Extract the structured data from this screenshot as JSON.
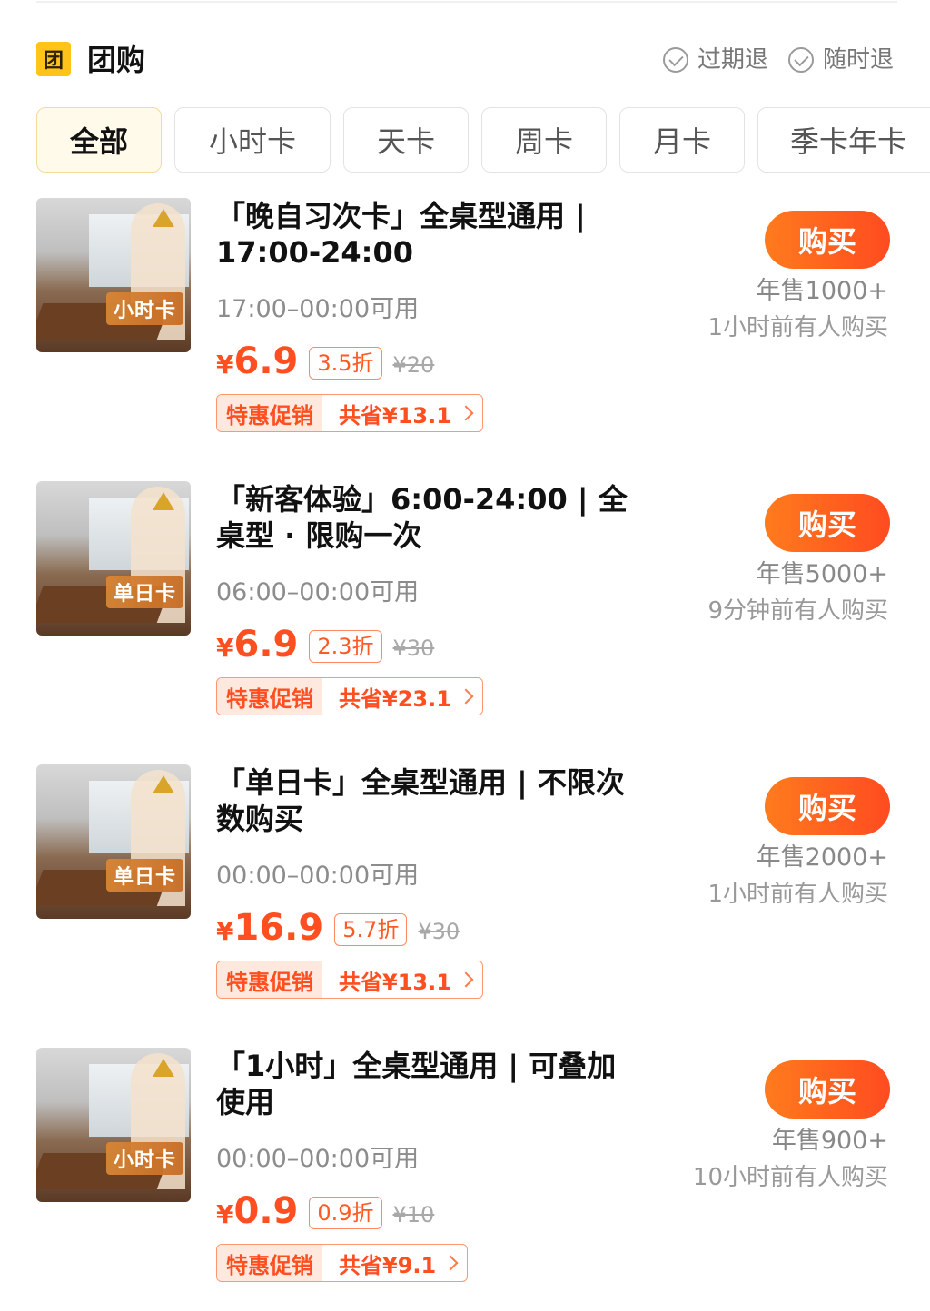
{
  "header": {
    "logo_char": "团",
    "title": "团购",
    "badges": [
      "过期退",
      "随时退"
    ]
  },
  "tabs": [
    "全部",
    "小时卡",
    "天卡",
    "周卡",
    "月卡",
    "季卡年卡"
  ],
  "active_tab": "全部",
  "items": [
    {
      "thumb_label": "小时卡",
      "title": "「晚自习次卡」全桌型通用 | 17:00-24:00",
      "time": "17:00–00:00可用",
      "price_symbol": "¥",
      "price": "6.9",
      "discount": "3.5折",
      "original": "¥20",
      "promo_tag": "特惠促销",
      "promo_save": "共省¥13.1",
      "buy": "购买",
      "sales": "年售1000+",
      "recent": "1小时前有人购买"
    },
    {
      "thumb_label": "单日卡",
      "title": "「新客体验」6:00-24:00 | 全桌型 · 限购一次",
      "time": "06:00–00:00可用",
      "price_symbol": "¥",
      "price": "6.9",
      "discount": "2.3折",
      "original": "¥30",
      "promo_tag": "特惠促销",
      "promo_save": "共省¥23.1",
      "buy": "购买",
      "sales": "年售5000+",
      "recent": "9分钟前有人购买"
    },
    {
      "thumb_label": "单日卡",
      "title": "「单日卡」全桌型通用 | 不限次数购买",
      "time": "00:00–00:00可用",
      "price_symbol": "¥",
      "price": "16.9",
      "discount": "5.7折",
      "original": "¥30",
      "promo_tag": "特惠促销",
      "promo_save": "共省¥13.1",
      "buy": "购买",
      "sales": "年售2000+",
      "recent": "1小时前有人购买"
    },
    {
      "thumb_label": "小时卡",
      "title": "「1小时」全桌型通用 | 可叠加使用",
      "time": "00:00–00:00可用",
      "price_symbol": "¥",
      "price": "0.9",
      "discount": "0.9折",
      "original": "¥10",
      "promo_tag": "特惠促销",
      "promo_save": "共省¥9.1",
      "buy": "购买",
      "sales": "年售900+",
      "recent": "10小时前有人购买"
    }
  ]
}
